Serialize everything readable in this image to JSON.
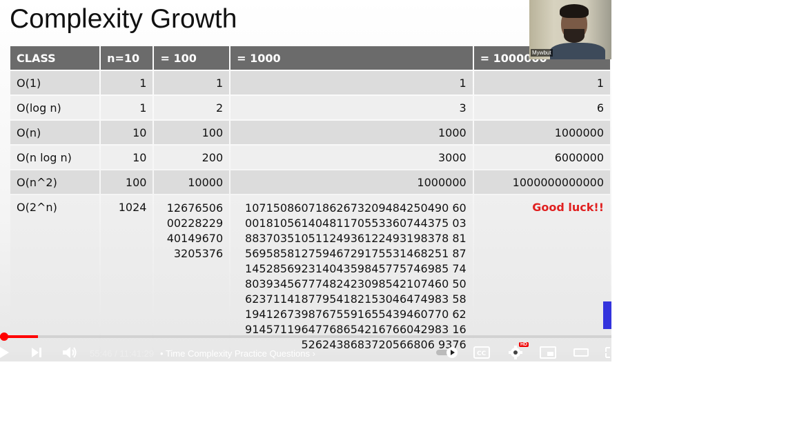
{
  "slide": {
    "title": "Complexity Growth",
    "headers": [
      "CLASS",
      "n=10",
      "= 100",
      "= 1000",
      "= 1000000"
    ],
    "rows": [
      {
        "class": "O(1)",
        "n10": "1",
        "n100": "1",
        "n1000": "1",
        "n1m": "1"
      },
      {
        "class": "O(log n)",
        "n10": "1",
        "n100": "2",
        "n1000": "3",
        "n1m": "6"
      },
      {
        "class": "O(n)",
        "n10": "10",
        "n100": "100",
        "n1000": "1000",
        "n1m": "1000000"
      },
      {
        "class": "O(n log n)",
        "n10": "10",
        "n100": "200",
        "n1000": "3000",
        "n1m": "6000000"
      },
      {
        "class": "O(n^2)",
        "n10": "100",
        "n100": "10000",
        "n1000": "1000000",
        "n1m": "1000000000000"
      },
      {
        "class": "O(2^n)",
        "n10": "1024",
        "n100": "12676506\n00228229\n40149670\n3205376",
        "n1000": "10715086071862673209484250490 60\n00181056140481170553360744375 03\n88370351051124936122493198378 81\n56958581275946729175531468251 87\n14528569231404359845775746985 74\n80393456777482423098542107460 50\n62371141877954182153046474983 58\n19412673987675591655439460770 62\n91457119647768654216766042983 16\n5262438683720566806 9376",
        "n1m": "Good luck!!"
      }
    ]
  },
  "webcam": {
    "label": "Mywbut"
  },
  "player": {
    "time_current": "55:46",
    "time_total": "11:41:29",
    "time_separator": "/",
    "chapter": "Time Complexity Practice Questions",
    "chapter_bullet": "•",
    "hd_label": "HD",
    "progress_fraction": 0.0013
  },
  "colors": {
    "accent_red": "#ff0000",
    "header_gray": "#6b6b6b",
    "good_luck": "#e02020"
  }
}
